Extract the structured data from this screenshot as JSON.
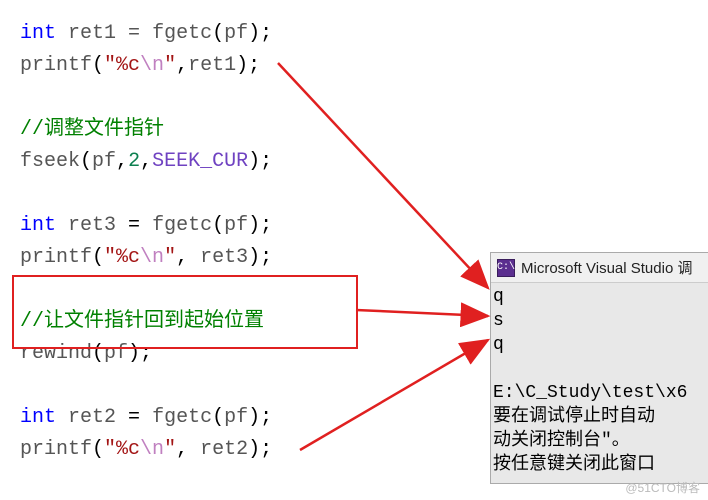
{
  "code": {
    "l1_kw": "int",
    "l1_var": "ret1",
    "l1_eq": " = ",
    "l1_fn": "fgetc",
    "l1_arg": "pf",
    "l2_fn": "printf",
    "l2_str_open": "\"%c",
    "l2_esc": "\\n",
    "l2_str_close": "\"",
    "l2_arg": "ret1",
    "comment1": "//调整文件指针",
    "l4_fn": "fseek",
    "l4_a1": "pf",
    "l4_a2": "2",
    "l4_a3": "SEEK_CUR",
    "l5_kw": "int",
    "l5_var": "ret3",
    "l5_fn": "fgetc",
    "l5_arg": "pf",
    "l6_fn": "printf",
    "l6_str_open": "\"%c",
    "l6_esc": "\\n",
    "l6_str_close": "\"",
    "l6_arg": "ret3",
    "comment2": "//让文件指针回到起始位置",
    "l8_fn": "rewind",
    "l8_arg": "pf",
    "l9_kw": "int",
    "l9_var": "ret2",
    "l9_fn": "fgetc",
    "l9_arg": "pf",
    "l10_fn": "printf",
    "l10_str_open": "\"%c",
    "l10_esc": "\\n",
    "l10_str_close": "\"",
    "l10_arg": "ret2"
  },
  "console": {
    "icon_text": "C:\\",
    "title": "Microsoft Visual Studio 调",
    "out1": "q",
    "out2": "s",
    "out3": "q",
    "blank": "",
    "path": "E:\\C_Study\\test\\x6",
    "msg1": "要在调试停止时自动",
    "msg2": "动关闭控制台\"。",
    "msg3": "按任意键关闭此窗口"
  },
  "watermark": "@51CTO博客"
}
